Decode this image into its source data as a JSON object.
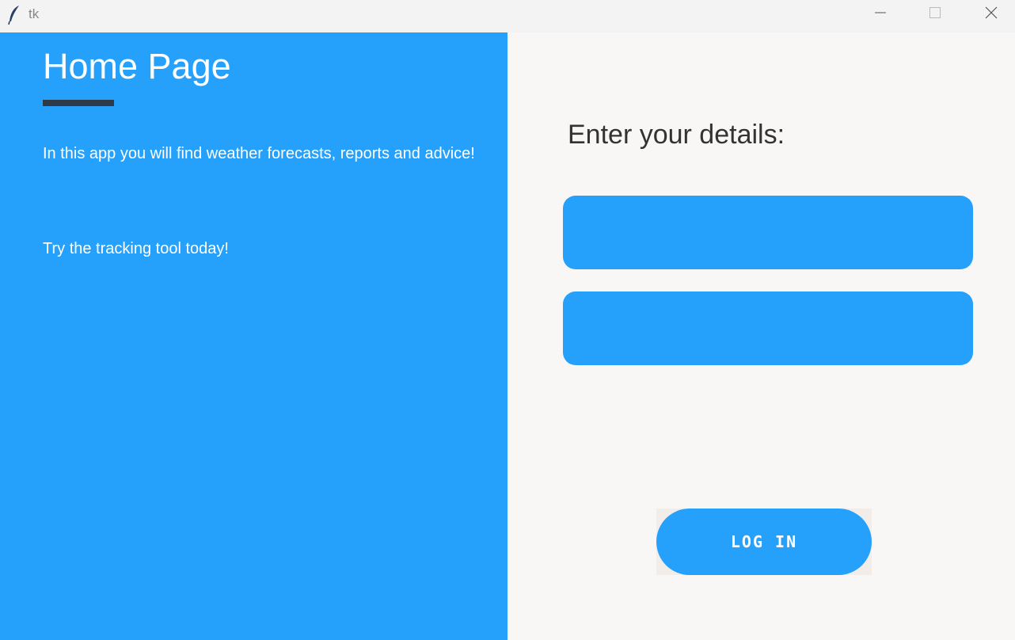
{
  "window": {
    "title": "tk"
  },
  "home": {
    "title": "Home Page",
    "intro": "In this app you will find weather forecasts, reports and advice!",
    "cta": "Try the tracking tool today!"
  },
  "login": {
    "heading": "Enter your details:",
    "username_value": "",
    "password_value": "",
    "button_label": "LOG IN"
  },
  "colors": {
    "accent": "#25a0fb",
    "panel_bg": "#f8f7f5",
    "heading_text": "#333333",
    "underline": "#2f3a48"
  },
  "icons": {
    "app": "feather-icon",
    "minimize": "minimize-icon",
    "maximize": "maximize-icon",
    "close": "close-icon"
  }
}
